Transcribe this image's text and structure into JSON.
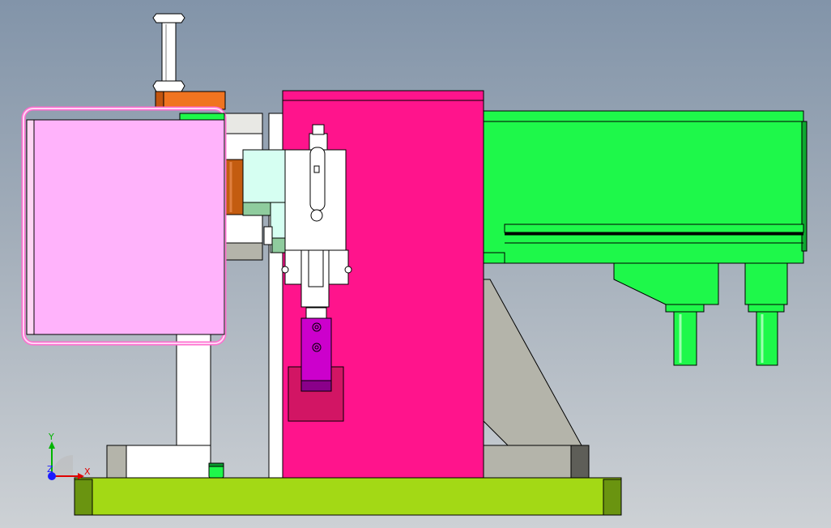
{
  "viewport": {
    "background_top": "#8294a9",
    "background_bottom": "#cdd1d5"
  },
  "part_colors": {
    "base_plate": "#a3d915",
    "column_block": "#ff148c",
    "slide_housing": "#1ef84a",
    "guard_box": "#ffb3fb",
    "top_nut": "#f07420",
    "fixture_block": "#cc00cc",
    "support_gusset": "#b4b4aa",
    "stand": "#ffffff"
  },
  "triad": {
    "x_label": "X",
    "y_label": "Y",
    "z_label": "Z"
  }
}
